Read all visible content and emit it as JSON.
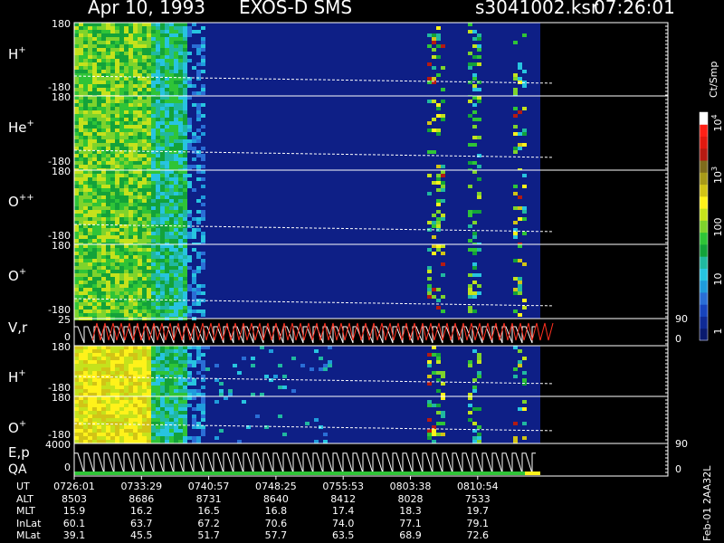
{
  "header": {
    "date": "Apr 10, 1993",
    "mission": "EXOS-D SMS",
    "file": "s3041002.ksr",
    "time": "07:26:01"
  },
  "colorbar": {
    "unit": "Ct/Smp",
    "ticks": [
      {
        "label": "1",
        "value": 1
      },
      {
        "label": "10",
        "value": 10
      },
      {
        "label": "100",
        "value": 100
      },
      {
        "label": "10",
        "sup": "3",
        "value": 1000
      },
      {
        "label": "10",
        "sup": "4",
        "value": 10000
      }
    ],
    "colors": [
      "#0a1a6e",
      "#0f2a96",
      "#1744bd",
      "#2a6ed6",
      "#1f9cdc",
      "#27c4e0",
      "#20b8a0",
      "#13a23a",
      "#2fc437",
      "#7ed32c",
      "#c5e21c",
      "#fff21a",
      "#d2c416",
      "#a89a18",
      "#7f6b1b",
      "#b51a12",
      "#e0190f",
      "#ff2016",
      "#ffffff"
    ]
  },
  "footer_code": "Feb-01 2AA32L",
  "chart_data": {
    "type": "heatmap",
    "time_axis": {
      "label": "UT",
      "ticks": [
        "0726:01",
        "0733:29",
        "0740:57",
        "0748:25",
        "0755:53",
        "0803:38",
        "0810:54"
      ]
    },
    "panels": [
      {
        "species": "H",
        "charge": "+",
        "ylim_labels": [
          "180",
          "-180"
        ],
        "kind": "spectrogram"
      },
      {
        "species": "He",
        "charge": "+",
        "ylim_labels": [
          "180",
          "-180"
        ],
        "kind": "spectrogram"
      },
      {
        "species": "O",
        "charge": "++",
        "ylim_labels": [
          "180",
          "-180"
        ],
        "kind": "spectrogram"
      },
      {
        "species": "O",
        "charge": "+",
        "ylim_labels": [
          "180",
          "-180"
        ],
        "kind": "spectrogram"
      },
      {
        "species": "V,r",
        "charge": "",
        "ylim_labels": [
          "25",
          "0"
        ],
        "right_ticks": [
          "90",
          "0"
        ],
        "kind": "line"
      },
      {
        "species": "H",
        "charge": "+",
        "ylim_labels": [
          "180",
          "-180"
        ],
        "kind": "spectrogram"
      },
      {
        "species": "O",
        "charge": "+",
        "ylim_labels": [
          "180",
          "-180"
        ],
        "kind": "spectrogram"
      },
      {
        "species": "E,p",
        "species2": "QA",
        "charge": "",
        "ylim_labels": [
          "4000",
          "0"
        ],
        "right_ticks": [
          "90",
          "0"
        ],
        "kind": "line"
      }
    ],
    "ephemeris": [
      {
        "name": "UT",
        "values": [
          "0726:01",
          "0733:29",
          "0740:57",
          "0748:25",
          "0755:53",
          "0803:38",
          "0810:54"
        ]
      },
      {
        "name": "ALT",
        "values": [
          "8503",
          "8686",
          "8731",
          "8640",
          "8412",
          "8028",
          "7533"
        ]
      },
      {
        "name": "MLT",
        "values": [
          "15.9",
          "16.2",
          "16.5",
          "16.8",
          "17.4",
          "18.3",
          "19.7"
        ]
      },
      {
        "name": "InLat",
        "values": [
          "60.1",
          "63.7",
          "67.2",
          "70.6",
          "74.0",
          "77.1",
          "79.1"
        ]
      },
      {
        "name": "MLat",
        "values": [
          "39.1",
          "45.5",
          "51.7",
          "57.7",
          "63.5",
          "68.9",
          "72.6"
        ]
      }
    ]
  }
}
